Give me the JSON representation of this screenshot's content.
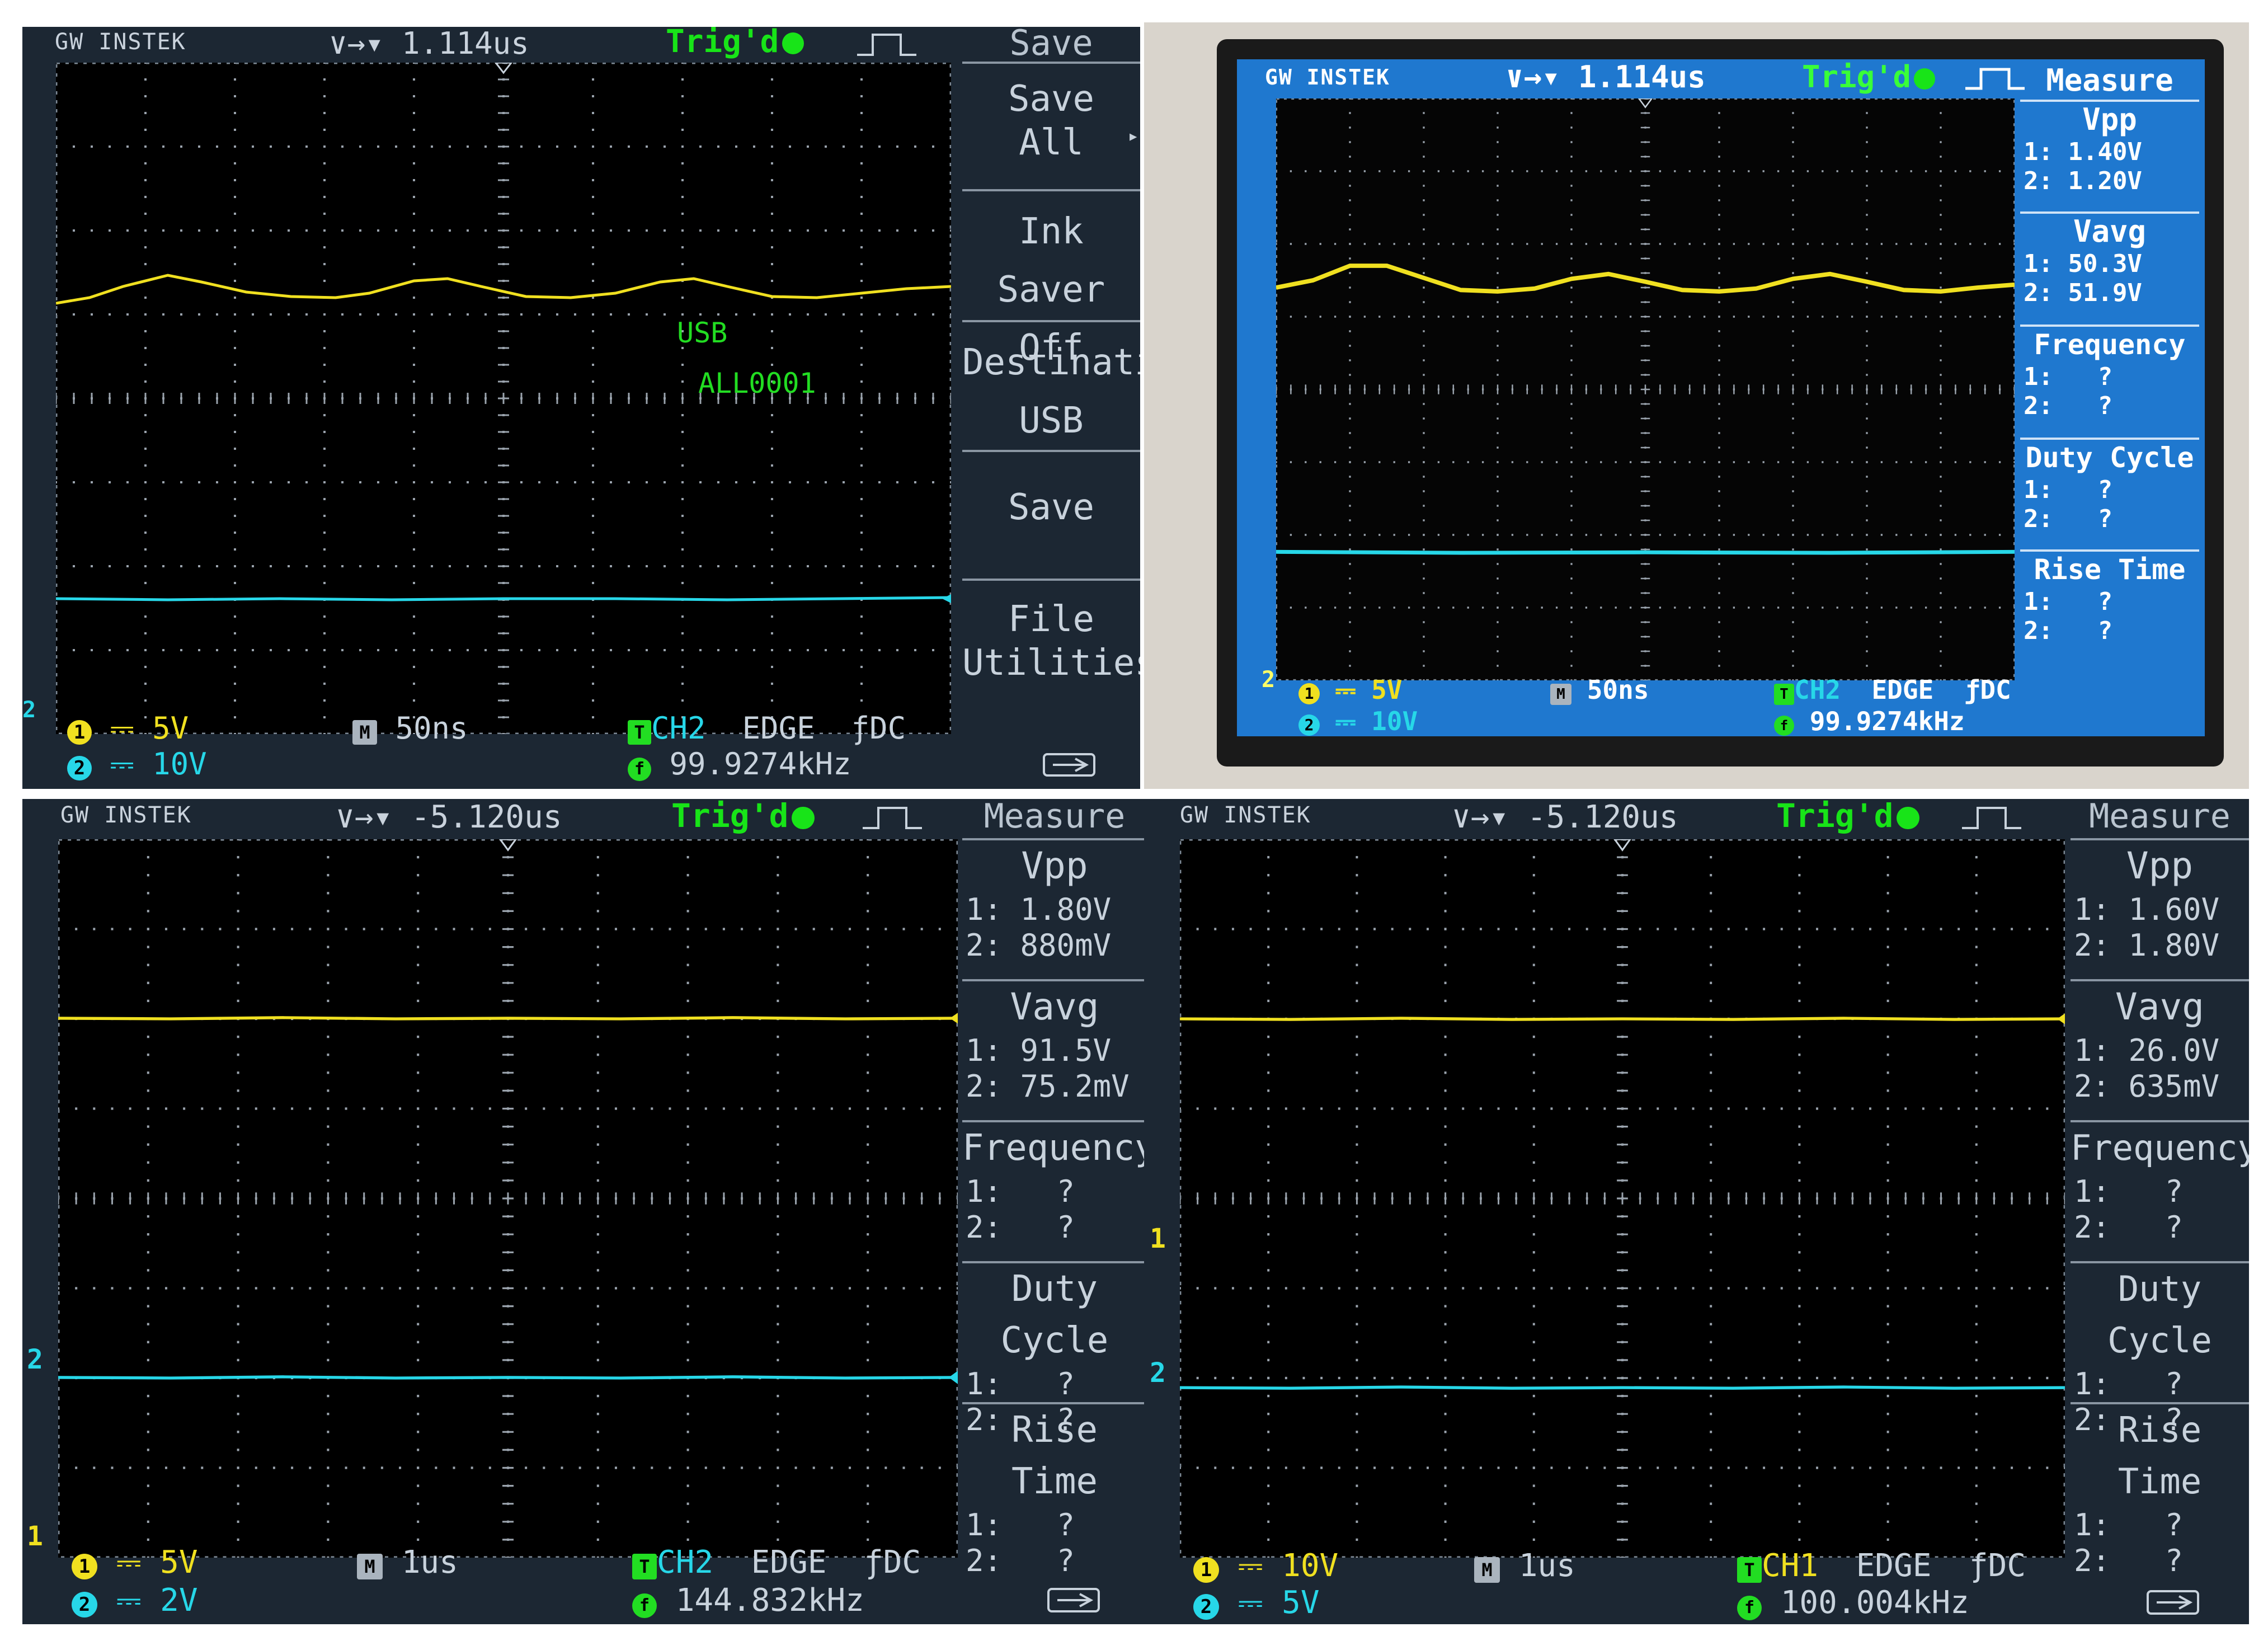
{
  "brand": "GW INSTEK",
  "panels": [
    {
      "id": "top-left",
      "horizontal_position": "1.114us",
      "trigger_status": "Trig'd",
      "menu_title": "Save",
      "menu": [
        {
          "line1": "Save",
          "line2": "All"
        },
        {
          "line1": "Ink Saver",
          "line2": "Off"
        },
        {
          "line1": "Destination",
          "line2": "USB"
        },
        {
          "line1": "Save",
          "line2": ""
        },
        {
          "line1": "File",
          "line2": "Utilities"
        }
      ],
      "overlay": {
        "line1": "USB",
        "line2": "ALL0001"
      },
      "ch1_scale": "5V",
      "ch2_scale": "10V",
      "timebase": "50ns",
      "trigger_source": "CH2",
      "trigger_type": "EDGE",
      "coupling": "DC",
      "frequency": "99.9274kHz",
      "ch1_marker": "1",
      "ch2_marker": "2"
    },
    {
      "id": "top-right",
      "horizontal_position": "1.114us",
      "trigger_status": "Trig'd",
      "menu_title": "Measure",
      "measurements": [
        {
          "name": "Vpp",
          "v1": "1: 1.40V",
          "v2": "2: 1.20V"
        },
        {
          "name": "Vavg",
          "v1": "1: 50.3V",
          "v2": "2: 51.9V"
        },
        {
          "name": "Frequency",
          "v1": "1:   ?",
          "v2": "2:   ?"
        },
        {
          "name": "Duty Cycle",
          "v1": "1:   ?",
          "v2": "2:   ?"
        },
        {
          "name": "Rise Time",
          "v1": "1:   ?",
          "v2": "2:   ?"
        }
      ],
      "ch1_scale": "5V",
      "ch2_scale": "10V",
      "timebase": "50ns",
      "trigger_source": "CH2",
      "trigger_type": "EDGE",
      "coupling": "DC",
      "frequency": "99.9274kHz",
      "ch2_marker": "2"
    },
    {
      "id": "bottom-left",
      "horizontal_position": "-5.120us",
      "trigger_status": "Trig'd",
      "menu_title": "Measure",
      "measurements": [
        {
          "name": "Vpp",
          "v1": "1: 1.80V",
          "v2": "2: 880mV"
        },
        {
          "name": "Vavg",
          "v1": "1: 91.5V",
          "v2": "2: 75.2mV"
        },
        {
          "name": "Frequency",
          "v1": "1:   ?",
          "v2": "2:   ?"
        },
        {
          "name": "Duty Cycle",
          "v1": "1:   ?",
          "v2": "2:   ?"
        },
        {
          "name": "Rise Time",
          "v1": "1:   ?",
          "v2": "2:   ?"
        }
      ],
      "ch1_scale": "5V",
      "ch2_scale": "2V",
      "timebase": "1us",
      "trigger_source": "CH2",
      "trigger_type": "EDGE",
      "coupling": "DC",
      "frequency": "144.832kHz",
      "ch1_marker": "1",
      "ch2_marker": "2"
    },
    {
      "id": "bottom-right",
      "horizontal_position": "-5.120us",
      "trigger_status": "Trig'd",
      "menu_title": "Measure",
      "measurements": [
        {
          "name": "Vpp",
          "v1": "1: 1.60V",
          "v2": "2: 1.80V"
        },
        {
          "name": "Vavg",
          "v1": "1: 26.0V",
          "v2": "2: 635mV"
        },
        {
          "name": "Frequency",
          "v1": "1:   ?",
          "v2": "2:   ?"
        },
        {
          "name": "Duty Cycle",
          "v1": "1:   ?",
          "v2": "2:   ?"
        },
        {
          "name": "Rise Time",
          "v1": "1:   ?",
          "v2": "2:   ?"
        }
      ],
      "ch1_scale": "10V",
      "ch2_scale": "5V",
      "timebase": "1us",
      "trigger_source": "CH1",
      "trigger_type": "EDGE",
      "coupling": "DC",
      "frequency": "100.004kHz",
      "ch1_marker": "1",
      "ch2_marker": "2"
    }
  ],
  "colors": {
    "ch1": "#f0e020",
    "ch2": "#27d7e8",
    "trigger": "#18e418",
    "grid_dots": "#9aa3ad",
    "panel_bg": "#1c2733",
    "photo_screen": "#1f78cf"
  }
}
